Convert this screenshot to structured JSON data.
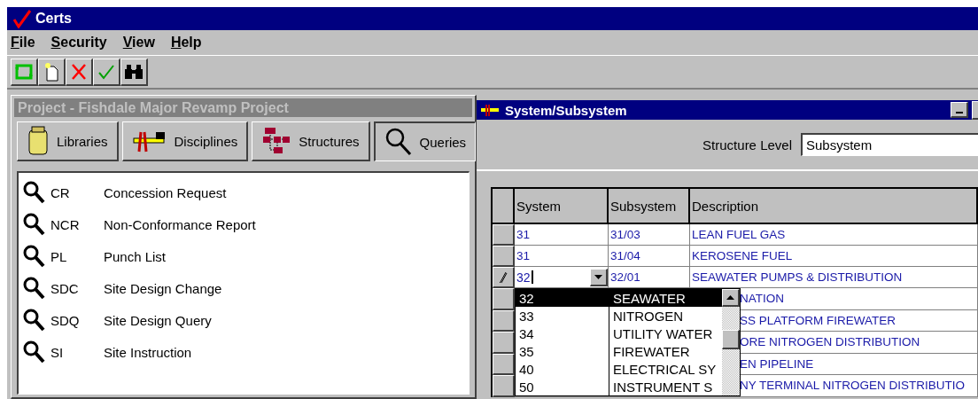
{
  "window": {
    "title": "Certs"
  },
  "menu": [
    "File",
    "Security",
    "View",
    "Help"
  ],
  "project_panel": {
    "title": "Project - Fishdale Major Revamp Project",
    "tabs": [
      {
        "label": "Libraries",
        "kind": "jar",
        "selected": false
      },
      {
        "label": "Disciplines",
        "kind": "tools",
        "selected": false
      },
      {
        "label": "Structures",
        "kind": "hierarchy",
        "selected": false
      },
      {
        "label": "Queries",
        "kind": "search",
        "selected": true
      }
    ],
    "queries": [
      {
        "code": "CR",
        "name": "Concession Request"
      },
      {
        "code": "NCR",
        "name": "Non-Conformance Report"
      },
      {
        "code": "PL",
        "name": "Punch List"
      },
      {
        "code": "SDC",
        "name": "Site Design Change"
      },
      {
        "code": "SDQ",
        "name": "Site Design Query"
      },
      {
        "code": "SI",
        "name": "Site Instruction"
      }
    ]
  },
  "child_window": {
    "title": "System/Subsystem",
    "structure_level_label": "Structure Level",
    "structure_level": "Subsystem",
    "columns": [
      "System",
      "Subsystem",
      "Description"
    ],
    "rows": [
      {
        "system": "31",
        "subsystem": "31/03",
        "description": "LEAN FUEL GAS",
        "editing": false
      },
      {
        "system": "31",
        "subsystem": "31/04",
        "description": "KEROSENE FUEL",
        "editing": false
      },
      {
        "system": "32",
        "subsystem": "32/01",
        "description": "SEAWATER PUMPS & DISTRIBUTION",
        "editing": true
      },
      {
        "description": "NATION",
        "editing": false
      },
      {
        "description": "SS PLATFORM FIREWATER",
        "editing": false
      },
      {
        "description": "ORE NITROGEN DISTRIBUTION",
        "editing": false
      },
      {
        "description": "EN PIPELINE",
        "editing": false
      },
      {
        "description": "NY TERMINAL NITROGEN DISTRIBUTIO",
        "editing": false
      }
    ],
    "dropdown": [
      {
        "code": "32",
        "name": "SEAWATER",
        "selected": true
      },
      {
        "code": "33",
        "name": "NITROGEN",
        "selected": false
      },
      {
        "code": "34",
        "name": "UTILITY WATER",
        "selected": false
      },
      {
        "code": "35",
        "name": "FIREWATER",
        "selected": false
      },
      {
        "code": "40",
        "name": "ELECTRICAL SY",
        "selected": false
      },
      {
        "code": "50",
        "name": "INSTRUMENT S",
        "selected": false
      }
    ]
  }
}
